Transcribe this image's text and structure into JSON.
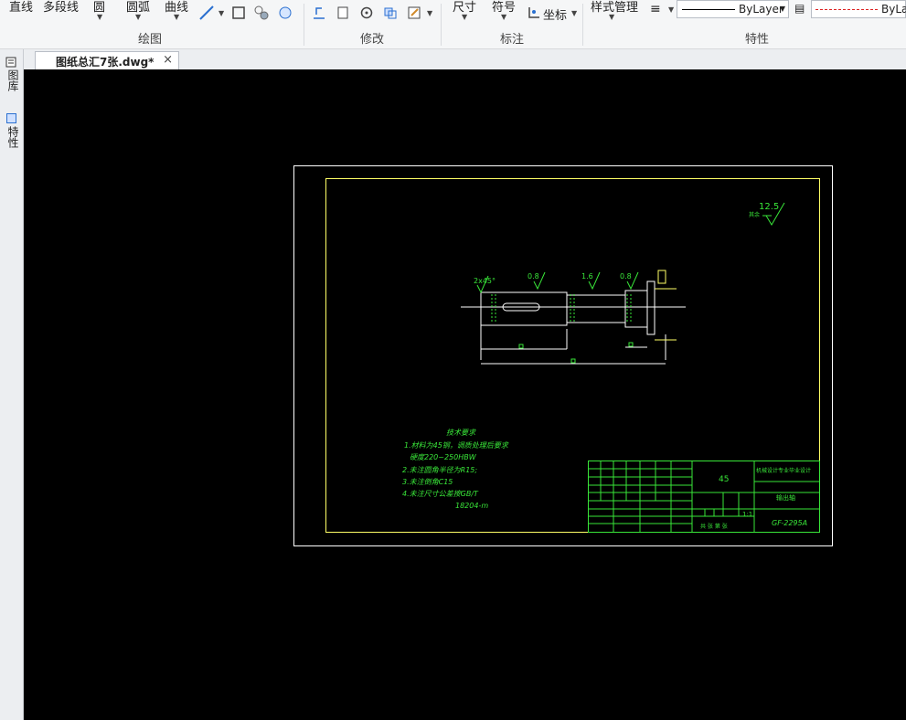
{
  "ribbon": {
    "draw": {
      "line": "直线",
      "polyline": "多段线",
      "circle": "圆",
      "arc": "圆弧",
      "curve": "曲线",
      "group_label": "绘图"
    },
    "modify": {
      "group_label": "修改"
    },
    "annotate": {
      "dimension": "尺寸",
      "symbol": "符号",
      "coordinate": "坐标",
      "group_label": "标注"
    },
    "properties": {
      "style_manager": "样式管理",
      "linetype1": "ByLayer",
      "linetype2": "ByLay",
      "group_label": "特性"
    }
  },
  "tab": {
    "label": "图纸总汇7张.dwg*",
    "close": "×"
  },
  "left_panel": {
    "layers": "图库",
    "properties": "特性"
  },
  "drawing": {
    "roughness_main": "12.5",
    "roughness_main_note": "其余",
    "dims": {
      "chamfer": "2x45°",
      "r1": "0.8",
      "r2": "1.6",
      "r3": "0.8"
    },
    "notes": {
      "title": "技术要求",
      "l1": "1.材料为45钢，调质处理后要求",
      "l2": "硬度220~250HBW",
      "l3": "2.未注圆角半径为R15;",
      "l4": "3.未注倒角C15",
      "l5": "4.未注尺寸公差按GB/T",
      "l6": "18204-m"
    },
    "title_block": {
      "material": "45",
      "org": "机械设计专业毕业设计",
      "part": "输出轴",
      "code": "GF-2295A",
      "scale": "1:1",
      "sheet": "共  张  第  张"
    }
  }
}
